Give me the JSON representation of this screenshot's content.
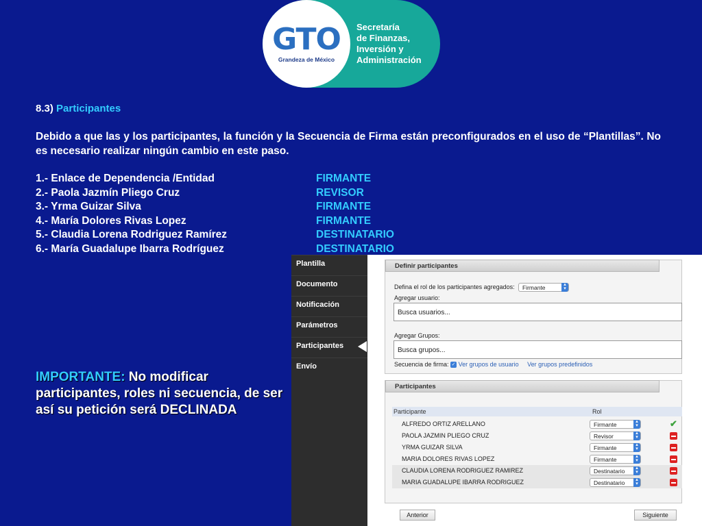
{
  "logo": {
    "mark": "GTO",
    "tagline": "Grandeza de México",
    "org_lines": [
      "Secretaría",
      "de Finanzas,",
      "Inversión y",
      "Administración"
    ]
  },
  "section": {
    "number": "8.3)",
    "title": "Participantes"
  },
  "paragraph": "Debido a que las y los participantes, la función y la Secuencia de Firma están preconfigurados en el uso de “Plantillas”. No es necesario realizar ningún cambio en este paso.",
  "participants_list": [
    {
      "name": "1.- Enlace de Dependencia /Entidad",
      "role": "FIRMANTE"
    },
    {
      "name": "2.- Paola Jazmín Pliego Cruz",
      "role": "REVISOR"
    },
    {
      "name": "3.- Yrma Guizar Silva",
      "role": "FIRMANTE"
    },
    {
      "name": "4.- María Dolores Rivas Lopez",
      "role": "FIRMANTE"
    },
    {
      "name": "5.- Claudia Lorena Rodriguez Ramírez",
      "role": "DESTINATARIO"
    },
    {
      "name": "6.- María Guadalupe Ibarra Rodríguez",
      "role": "DESTINATARIO"
    }
  ],
  "important": {
    "label": "IMPORTANTE:",
    "line1": " No modificar",
    "line2": "participantes, roles ni secuencia, de ser",
    "line3": "así su petición será DECLINADA"
  },
  "sidebar": {
    "items": [
      {
        "label": "Plantilla"
      },
      {
        "label": "Documento"
      },
      {
        "label": "Notificación"
      },
      {
        "label": "Parámetros"
      },
      {
        "label": "Participantes"
      },
      {
        "label": "Envío"
      }
    ],
    "active_index": 4
  },
  "define": {
    "title": "Definir participantes",
    "role_label": "Defina el rol de los participantes agregados:",
    "role_value": "Firmante",
    "user_label": "Agregar usuario:",
    "user_placeholder": "Busca usuarios...",
    "group_label": "Agregar Grupos:",
    "group_placeholder": "Busca grupos...",
    "sequence_label": "Secuencia de firma:",
    "link_user_groups": "Ver grupos de usuario",
    "link_predefined": "Ver grupos predefinidos"
  },
  "participants_table": {
    "title": "Participantes",
    "col_participant": "Participante",
    "col_role": "Rol",
    "rows": [
      {
        "name": "ALFREDO ORTIZ ARELLANO",
        "role": "Firmante",
        "action": "check"
      },
      {
        "name": "PAOLA JAZMIN PLIEGO CRUZ",
        "role": "Revisor",
        "action": "remove"
      },
      {
        "name": "YRMA GUIZAR SILVA",
        "role": "Firmante",
        "action": "remove"
      },
      {
        "name": "MARIA DOLORES RIVAS LOPEZ",
        "role": "Firmante",
        "action": "remove"
      },
      {
        "name": "CLAUDIA LORENA RODRIGUEZ RAMIREZ",
        "role": "Destinatario",
        "action": "remove"
      },
      {
        "name": "MARIA GUADALUPE IBARRA RODRIGUEZ",
        "role": "Destinatario",
        "action": "remove"
      }
    ]
  },
  "buttons": {
    "prev": "Anterior",
    "next": "Siguiente"
  },
  "colors": {
    "background": "#0a1a8f",
    "highlight": "#33ccff",
    "teal": "#17a89a"
  }
}
